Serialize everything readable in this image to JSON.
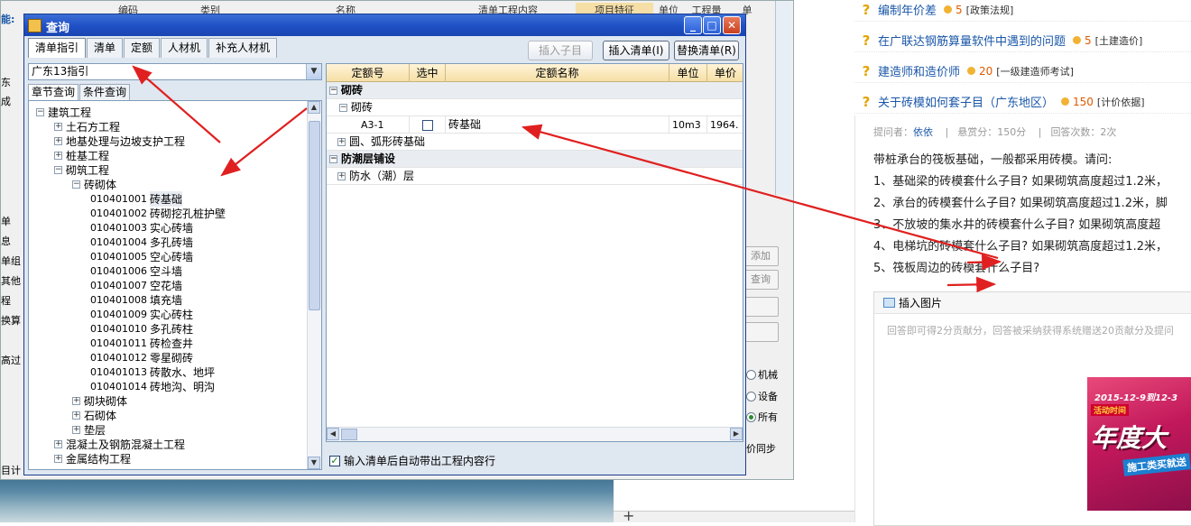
{
  "dialog": {
    "title": "查询",
    "tabs": [
      "清单指引",
      "清单",
      "定额",
      "人材机",
      "补充人材机"
    ],
    "buttons": {
      "insert_child": "插入子目",
      "insert_list": "插入清单(I)",
      "replace_list": "替换清单(R)"
    },
    "combo_value": "广东13指引",
    "subtabs": [
      "章节查询",
      "条件查询"
    ],
    "tree": [
      {
        "label": "建筑工程",
        "level": 0,
        "expanded": true
      },
      {
        "label": "土石方工程",
        "level": 1,
        "expanded": false
      },
      {
        "label": "地基处理与边坡支护工程",
        "level": 1,
        "expanded": false
      },
      {
        "label": "桩基工程",
        "level": 1,
        "expanded": false
      },
      {
        "label": "砌筑工程",
        "level": 1,
        "expanded": true
      },
      {
        "label": "砖砌体",
        "level": 2,
        "expanded": true
      },
      {
        "code": "010401001",
        "label": "砖基础",
        "level": 3,
        "selected": true
      },
      {
        "code": "010401002",
        "label": "砖砌挖孔桩护壁",
        "level": 3
      },
      {
        "code": "010401003",
        "label": "实心砖墙",
        "level": 3
      },
      {
        "code": "010401004",
        "label": "多孔砖墙",
        "level": 3
      },
      {
        "code": "010401005",
        "label": "空心砖墙",
        "level": 3
      },
      {
        "code": "010401006",
        "label": "空斗墙",
        "level": 3
      },
      {
        "code": "010401007",
        "label": "空花墙",
        "level": 3
      },
      {
        "code": "010401008",
        "label": "填充墙",
        "level": 3
      },
      {
        "code": "010401009",
        "label": "实心砖柱",
        "level": 3
      },
      {
        "code": "010401010",
        "label": "多孔砖柱",
        "level": 3
      },
      {
        "code": "010401011",
        "label": "砖检查井",
        "level": 3
      },
      {
        "code": "010401012",
        "label": "零星砌砖",
        "level": 3
      },
      {
        "code": "010401013",
        "label": "砖散水、地坪",
        "level": 3
      },
      {
        "code": "010401014",
        "label": "砖地沟、明沟",
        "level": 3
      },
      {
        "label": "砌块砌体",
        "level": 2,
        "expanded": false
      },
      {
        "label": "石砌体",
        "level": 2,
        "expanded": false
      },
      {
        "label": "垫层",
        "level": 2,
        "expanded": false
      },
      {
        "label": "混凝土及钢筋混凝土工程",
        "level": 1,
        "expanded": false
      },
      {
        "label": "金属结构工程",
        "level": 1,
        "expanded": false
      }
    ],
    "grid": {
      "headers": [
        "定额号",
        "选中",
        "定额名称",
        "单位",
        "单价"
      ],
      "rows": [
        {
          "type": "group",
          "name": "砌砖",
          "exp": "−"
        },
        {
          "type": "sub",
          "name": "砌砖",
          "exp": "−"
        },
        {
          "type": "item",
          "code": "A3-1",
          "name": "砖基础",
          "unit": "10m3",
          "price": "1964."
        },
        {
          "type": "sub2",
          "name": "圆、弧形砖基础",
          "exp": "+"
        },
        {
          "type": "group",
          "name": "防潮层铺设",
          "exp": "−"
        },
        {
          "type": "sub2",
          "name": "防水（潮）层",
          "exp": "+"
        }
      ]
    },
    "auto_bring_label": "输入清单后自动带出工程内容行"
  },
  "background_app": {
    "header_cols": [
      "编码",
      "类别",
      "名称",
      "清单工程内容",
      "项目特征",
      "单位",
      "工程量",
      "单"
    ],
    "left_fragments": [
      "能:",
      "东",
      "成",
      "单",
      "息",
      "单组",
      "其他",
      "程",
      "换算",
      "高过",
      "目计"
    ],
    "right_buttons": [
      "添加",
      "查询"
    ],
    "radios": [
      "机械",
      "设备",
      "所有"
    ],
    "sync_label": "价同步"
  },
  "web": {
    "questions": [
      {
        "title": "编制年价差",
        "score": "5",
        "category": "[政策法规]"
      },
      {
        "title": "在广联达钢筋算量软件中遇到的问题",
        "score": "5",
        "category": "[土建造价]"
      },
      {
        "title": "建造师和造价师",
        "score": "20",
        "category": "[一级建造师考试]"
      },
      {
        "title": "关于砖模如何套子目（广东地区）",
        "score": "150",
        "category": "[计价依据]"
      }
    ],
    "meta": {
      "asker_label": "提问者：",
      "asker": "依依",
      "reward": "悬赏分：150分",
      "answers": "回答次数：2次"
    },
    "body_lines": [
      "带桩承台的筏板基础，一般都采用砖模。请问:",
      "1、基础梁的砖模套什么子目? 如果砌筑高度超过1.2米，",
      "2、承台的砖模套什么子目? 如果砌筑高度超过1.2米，脚",
      "3、不放坡的集水井的砖模套什么子目? 如果砌筑高度超",
      "4、电梯坑的砖模套什么子目? 如果砌筑高度超过1.2米，",
      "5、筏板周边的砖模套什么子目?"
    ],
    "insert_image": "插入图片",
    "placeholder": "回答即可得2分贡献分，回答被采纳获得系统赠送20贡献分及提问",
    "ad": {
      "date": "2015-12-9到12-3",
      "activity": "活动时间",
      "big": "年度大",
      "sub": "施工类买就送"
    }
  },
  "colors": {
    "titlebar": "#1f4fc5",
    "arrow": "#e02020",
    "link": "#1a57a8",
    "score": "#e05a00"
  }
}
